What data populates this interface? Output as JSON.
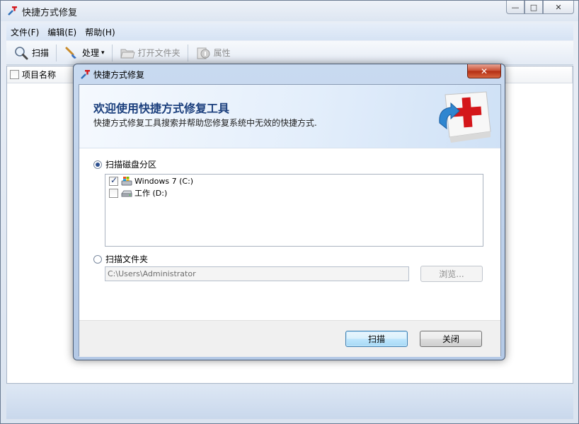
{
  "window": {
    "title": "快捷方式修复",
    "caption": {
      "minimize": "—",
      "maximize": "□",
      "close": "✕"
    }
  },
  "menu": [
    "文件(F)",
    "编辑(E)",
    "帮助(H)"
  ],
  "toolbar": {
    "scan": "扫描",
    "process": "处理",
    "process_arrow": "▾",
    "open_folder": "打开文件夹",
    "properties": "属性"
  },
  "list": {
    "header_name": "项目名称"
  },
  "dialog": {
    "title": "快捷方式修复",
    "close_glyph": "✕",
    "banner_title": "欢迎使用快捷方式修复工具",
    "banner_desc": "快捷方式修复工具搜索并帮助您修复系统中无效的快捷方式.",
    "option_scan_drive": "扫描磁盘分区",
    "drives": [
      {
        "label": "Windows 7 (C:)",
        "checked": true
      },
      {
        "label": "工作 (D:)",
        "checked": false
      }
    ],
    "option_scan_folder": "扫描文件夹",
    "folder_path": "C:\\Users\\Administrator",
    "browse_label": "浏览...",
    "scan_button": "扫描",
    "close_button": "关闭"
  },
  "colors": {
    "banner_title": "#1b3f7d",
    "accent_red": "#d4161a",
    "close_red": "#c74b2f"
  }
}
